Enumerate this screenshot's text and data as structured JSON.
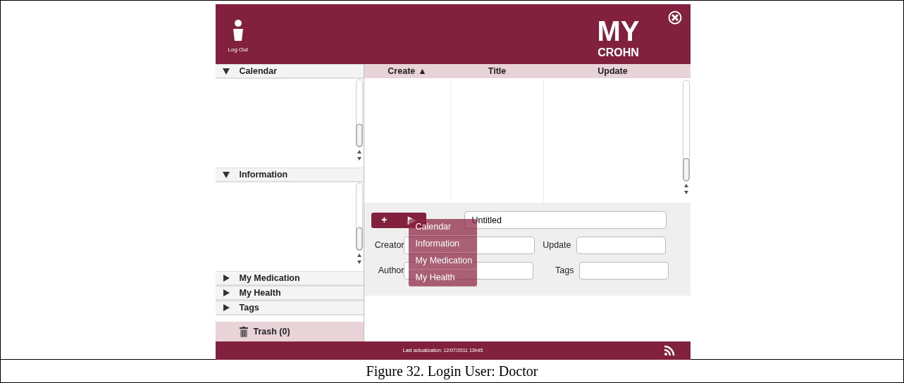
{
  "header": {
    "logout_label": "Log Out",
    "logo": [
      "MY",
      "CROHN"
    ]
  },
  "sidebar": {
    "sections": [
      {
        "label": "Calendar",
        "expanded": true
      },
      {
        "label": "Information",
        "expanded": true
      },
      {
        "label": "My Medication",
        "expanded": false
      },
      {
        "label": "My Health",
        "expanded": false
      },
      {
        "label": "Tags",
        "expanded": false
      }
    ],
    "trash": "Trash (0)"
  },
  "table": {
    "columns": [
      {
        "label": "Create",
        "sort_mark": "▲"
      },
      {
        "label": "Title"
      },
      {
        "label": "Update"
      }
    ]
  },
  "form": {
    "add_button": "+",
    "arrow": "▶",
    "title_value": "Untitled",
    "fields": [
      {
        "label": "Creator"
      },
      {
        "label": "Update"
      },
      {
        "label": "Author"
      },
      {
        "label": "Tags"
      }
    ]
  },
  "menu": {
    "items": [
      "Calendar",
      "Information",
      "My Medication",
      "My Health"
    ]
  },
  "status_bar": {
    "text": "Last actualization: 12/07/2011 13h45"
  },
  "caption": "Figure 32. Login User: Doctor"
}
